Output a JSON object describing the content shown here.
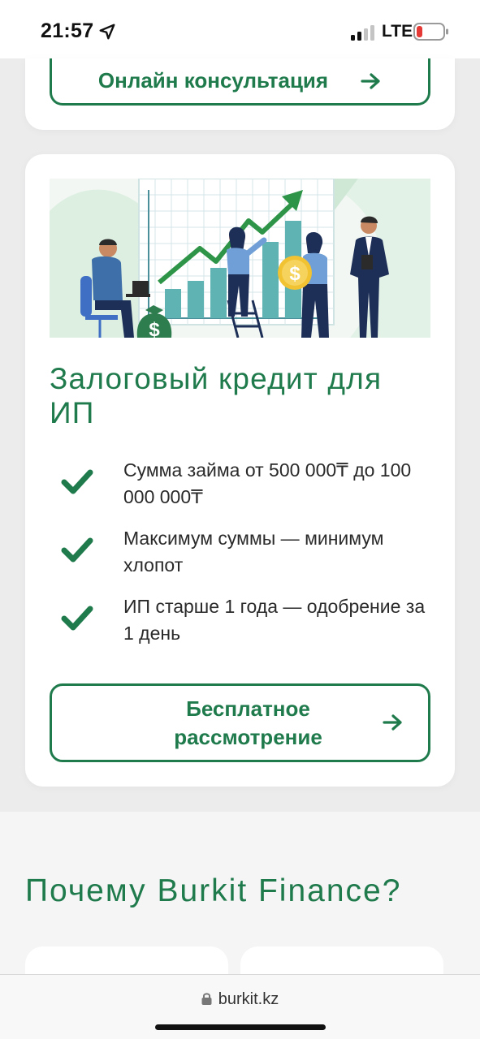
{
  "status_bar": {
    "time": "21:57",
    "network": "LTE",
    "icons": [
      "location-arrow-icon",
      "signal-icon",
      "battery-low-icon"
    ],
    "battery_color": "#e53935"
  },
  "top_card": {
    "button_label": "Онлайн консультация",
    "button_icon": "arrow-right-icon"
  },
  "loan_card": {
    "illustration": "business-growth-illustration",
    "title": "Залоговый кредит для ИП",
    "benefits": [
      "Сумма займа от 500 000₸ до 100 000 000₸",
      "Максимум суммы — минимум хлопот",
      "ИП старше 1 года — одобрение за 1 день"
    ],
    "benefit_icon": "checkmark-icon",
    "button_label": "Бесплатное рассмотрение",
    "button_icon": "arrow-right-icon"
  },
  "why_section": {
    "title": "Почему Burkit Finance?"
  },
  "browser": {
    "url": "burkit.kz"
  },
  "colors": {
    "accent": "#1f7a4c",
    "text": "#2a2a2a",
    "page_bg": "#ececed",
    "card_bg": "#ffffff"
  }
}
